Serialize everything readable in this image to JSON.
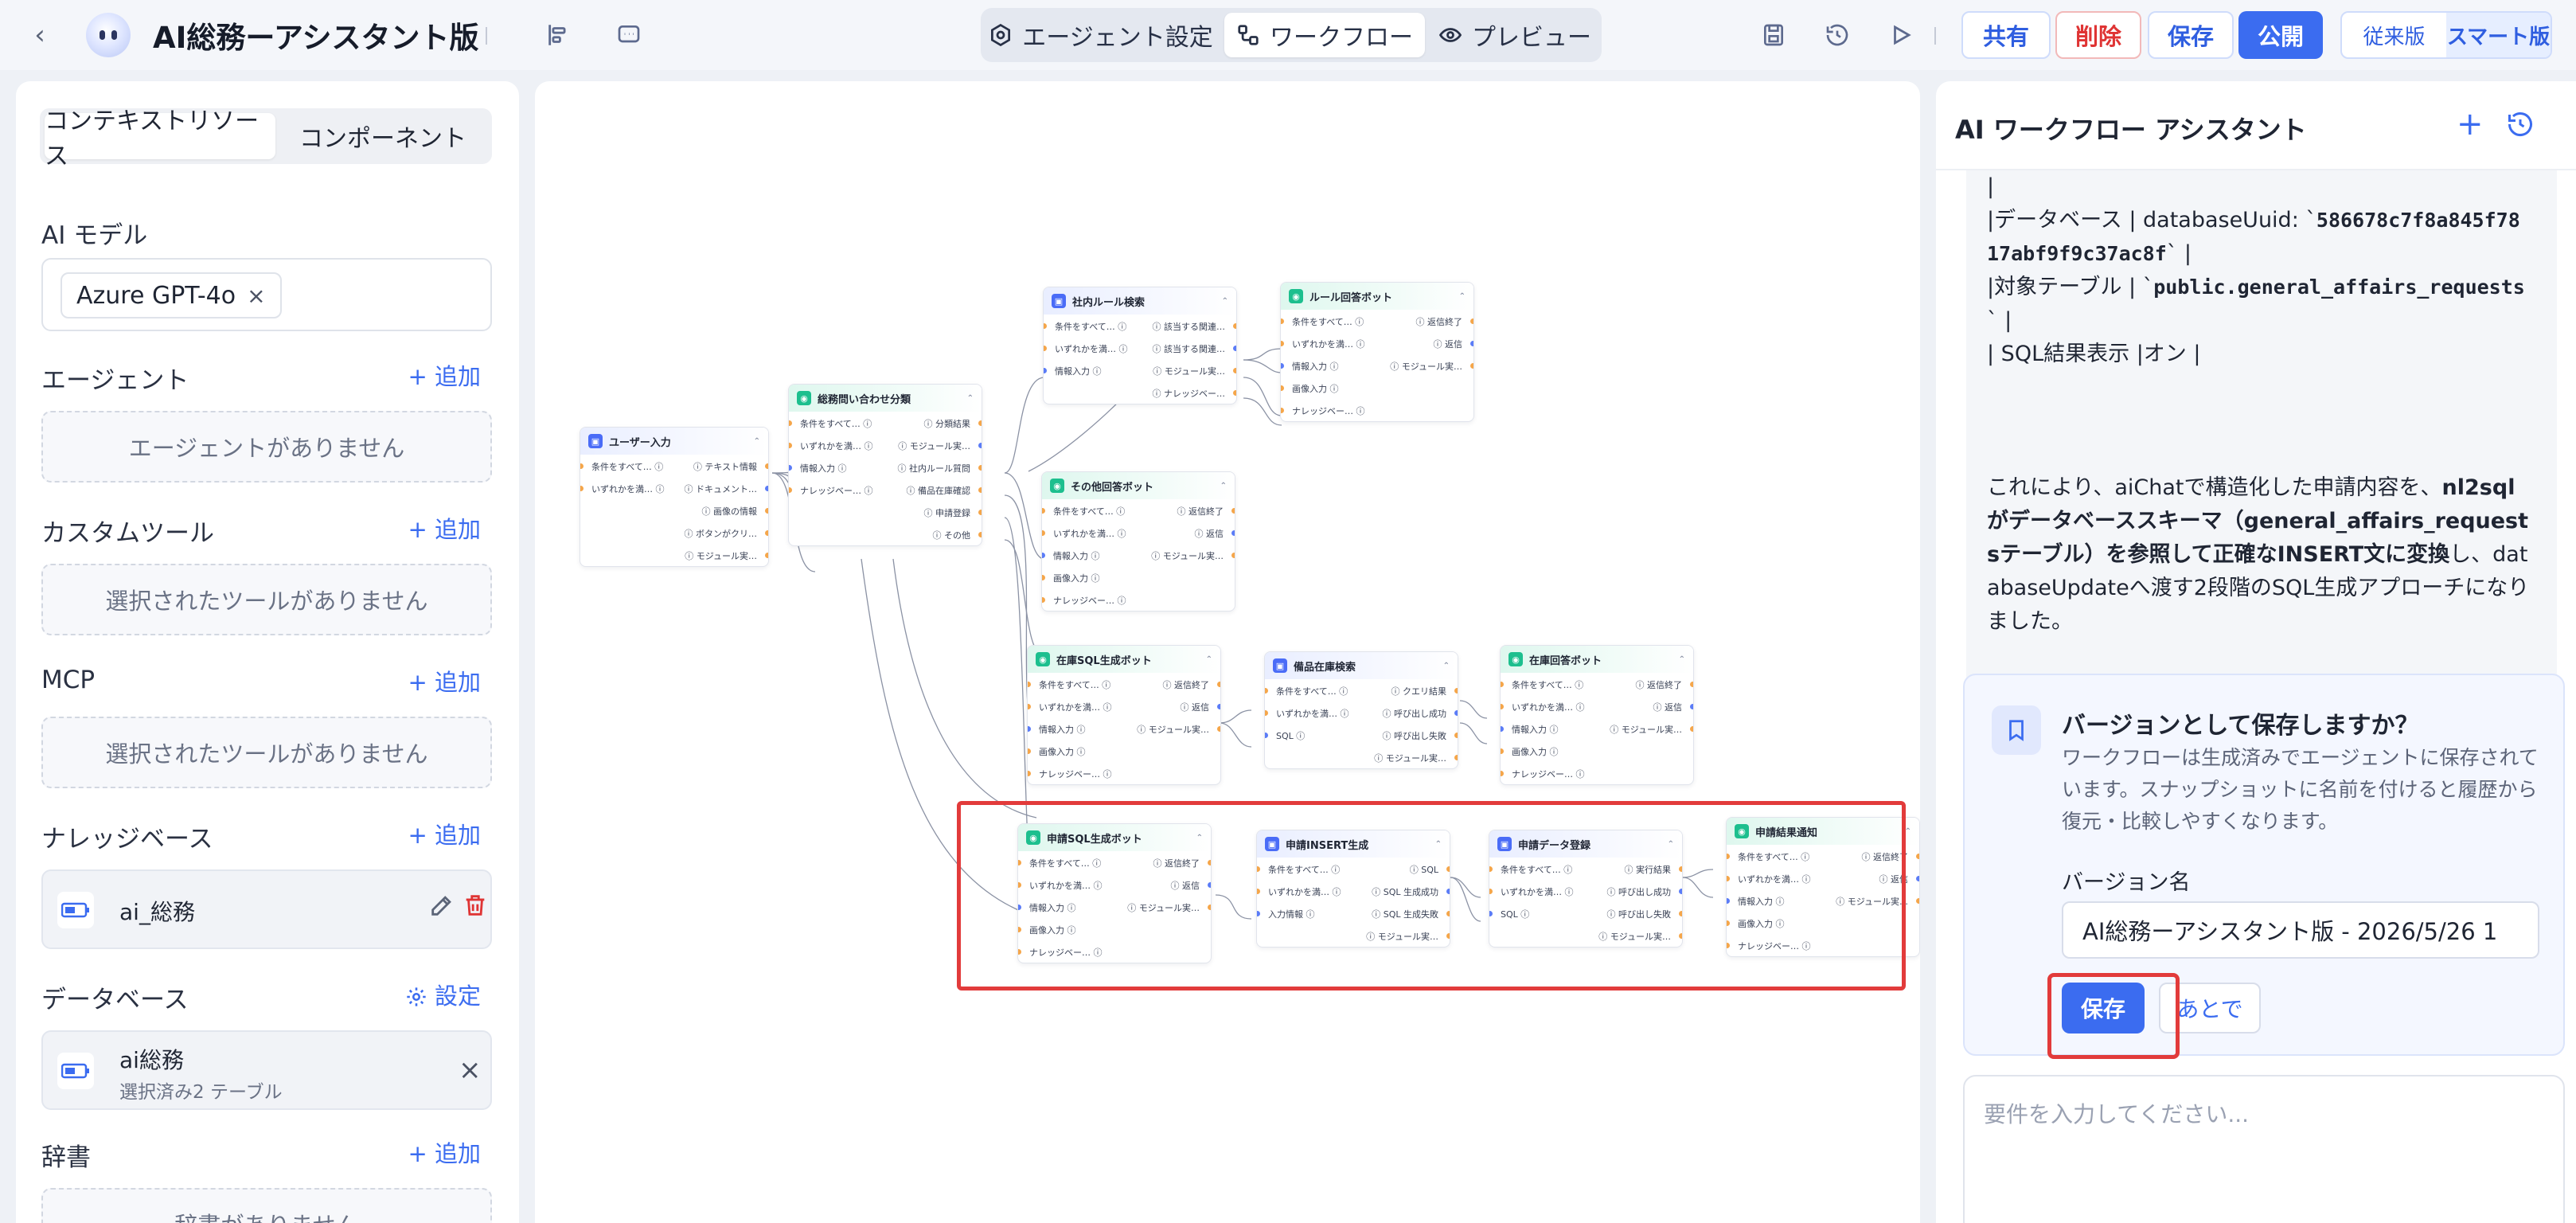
{
  "app": {
    "title": "AI総務ーアシスタント版",
    "tabs": [
      {
        "label": "エージェント設定",
        "icon": "gear-icon"
      },
      {
        "label": "ワークフロー",
        "icon": "workflow-icon"
      },
      {
        "label": "プレビュー",
        "icon": "eye-icon"
      }
    ],
    "buttons": {
      "share": "共有",
      "delete": "削除",
      "save": "保存",
      "publish": "公開"
    },
    "version_toggle": [
      "従来版",
      "スマート版"
    ]
  },
  "sidebar": {
    "tabs": [
      "コンテキストリソース",
      "コンポーネント"
    ],
    "ai_model": {
      "title": "AI モデル",
      "chip": "Azure GPT-4o"
    },
    "agent": {
      "title": "エージェント",
      "add": "追加",
      "empty": "エージェントがありません"
    },
    "custom_tool": {
      "title": "カスタムツール",
      "add": "追加",
      "empty": "選択されたツールがありません"
    },
    "mcp": {
      "title": "MCP",
      "add": "追加",
      "empty": "選択されたツールがありません"
    },
    "knowledge": {
      "title": "ナレッジベース",
      "add": "追加",
      "item": "ai_総務"
    },
    "database": {
      "title": "データベース",
      "settings": "設定",
      "name": "ai総務",
      "sub": "選択済み2 テーブル"
    },
    "dictionary": {
      "title": "辞書",
      "add": "追加",
      "empty": "辞書がありません"
    }
  },
  "workflow": {
    "nodes": [
      {
        "id": "user-input",
        "title": "ユーザー入力",
        "color": "blue",
        "left": [
          "条件をすべて…",
          "いずれかを満…"
        ],
        "right": [
          "テキスト情報",
          "ドキュメント…",
          "画像の情報",
          "ボタンがクリ…",
          "モジュール実…"
        ]
      },
      {
        "id": "classify",
        "title": "総務問い合わせ分類",
        "color": "green",
        "left": [
          "条件をすべて…",
          "いずれかを満…",
          "情報入力",
          "ナレッジベー…"
        ],
        "right": [
          "分類結果",
          "モジュール実…",
          "社内ルール質問",
          "備品在庫確認",
          "申請登録",
          "その他"
        ]
      },
      {
        "id": "rule-search",
        "title": "社内ルール検索",
        "color": "blue",
        "left": [
          "条件をすべて…",
          "いずれかを満…",
          "情報入力"
        ],
        "right": [
          "該当する関連…",
          "該当する関連…",
          "モジュール実…",
          "ナレッジベー…"
        ]
      },
      {
        "id": "rule-bot",
        "title": "ルール回答ボット",
        "color": "green",
        "left": [
          "条件をすべて…",
          "いずれかを満…",
          "情報入力",
          "画像入力",
          "ナレッジベー…"
        ],
        "right": [
          "返信終了",
          "返信",
          "モジュール実…"
        ]
      },
      {
        "id": "other-bot",
        "title": "その他回答ボット",
        "color": "green",
        "left": [
          "条件をすべて…",
          "いずれかを満…",
          "情報入力",
          "画像入力",
          "ナレッジベー…"
        ],
        "right": [
          "返信終了",
          "返信",
          "モジュール実…"
        ]
      },
      {
        "id": "stock-sql-bot",
        "title": "在庫SQL生成ボット",
        "color": "green",
        "left": [
          "条件をすべて…",
          "いずれかを満…",
          "情報入力",
          "画像入力",
          "ナレッジベー…"
        ],
        "right": [
          "返信終了",
          "返信",
          "モジュール実…"
        ]
      },
      {
        "id": "stock-search",
        "title": "備品在庫検索",
        "color": "blue",
        "left": [
          "条件をすべて…",
          "いずれかを満…",
          "SQL"
        ],
        "right": [
          "クエリ結果",
          "呼び出し成功",
          "呼び出し失敗",
          "モジュール実…"
        ]
      },
      {
        "id": "stock-bot",
        "title": "在庫回答ボット",
        "color": "green",
        "left": [
          "条件をすべて…",
          "いずれかを満…",
          "情報入力",
          "画像入力",
          "ナレッジベー…"
        ],
        "right": [
          "返信終了",
          "返信",
          "モジュール実…"
        ]
      },
      {
        "id": "req-sql-bot",
        "title": "申請SQL生成ボット",
        "color": "green",
        "left": [
          "条件をすべて…",
          "いずれかを満…",
          "情報入力",
          "画像入力",
          "ナレッジベー…"
        ],
        "right": [
          "返信終了",
          "返信",
          "モジュール実…"
        ]
      },
      {
        "id": "req-insert",
        "title": "申請INSERT生成",
        "color": "blue",
        "left": [
          "条件をすべて…",
          "いずれかを満…",
          "入力情報"
        ],
        "right": [
          "SQL",
          "SQL 生成成功",
          "SQL 生成失敗",
          "モジュール実…"
        ]
      },
      {
        "id": "req-register",
        "title": "申請データ登録",
        "color": "blue",
        "left": [
          "条件をすべて…",
          "いずれかを満…",
          "SQL"
        ],
        "right": [
          "実行結果",
          "呼び出し成功",
          "呼び出し失敗",
          "モジュール実…"
        ]
      },
      {
        "id": "req-notify",
        "title": "申請結果通知",
        "color": "green",
        "left": [
          "条件をすべて…",
          "いずれかを満…",
          "情報入力",
          "画像入力",
          "ナレッジベー…"
        ],
        "right": [
          "返信終了",
          "返信",
          "モジュール実…"
        ]
      }
    ]
  },
  "assistant": {
    "title": "AI ワークフロー アシスタント",
    "message": {
      "line0": "|",
      "db_label": "|データベース | databaseUuid: `",
      "db_code_1": "586678c7f8a845f78",
      "db_code_2": "17abf9f9c37ac8f",
      "db_tail": "` |",
      "table_label": "|対象テーブル | `",
      "table_code": "public.general_affairs_requests",
      "table_tail": "` |",
      "sql_line": "| SQL結果表示 |オン |",
      "p_pre": "これにより、aiChatで構造化した申請内容を、",
      "p_bold": "nl2sqlがデータベーススキーマ（general_affairs_requestsテーブル）を参照して正確なINSERT文に変換",
      "p_post": "し、databaseUpdateへ渡す2段階のSQL生成アプローチになりました。"
    },
    "save_card": {
      "title": "バージョンとして保存しますか？",
      "desc": "ワークフローは生成済みでエージェントに保存されています。スナップショットに名前を付けると履歴から復元・比較しやすくなります。",
      "label": "バージョン名",
      "value": "AI総務ーアシスタント版 - 2026/5/26 1",
      "save": "保存",
      "later": "あとで"
    },
    "composer_placeholder": "要件を入力してください..."
  }
}
